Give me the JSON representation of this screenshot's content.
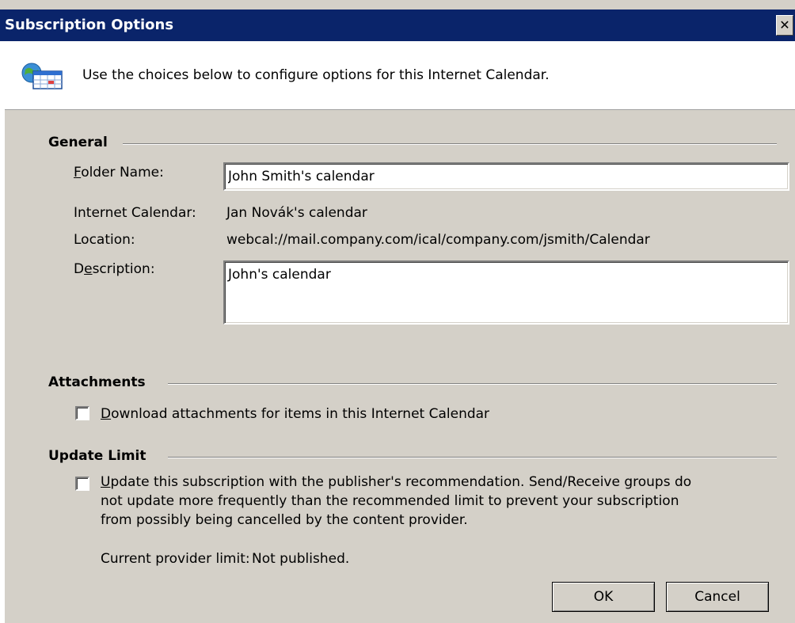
{
  "window": {
    "title": "Subscription Options",
    "close_glyph": "✕"
  },
  "header": {
    "icon": "internet-calendar-icon",
    "text": "Use the choices below to configure options for this Internet Calendar."
  },
  "general": {
    "heading": "General",
    "folder_name": {
      "accel": "F",
      "rest": "older Name:",
      "value": "John Smith's calendar"
    },
    "internet_calendar": {
      "label": "Internet Calendar:",
      "value": "Jan Novák's calendar"
    },
    "location": {
      "label": "Location:",
      "value": "webcal://mail.company.com/ical/company.com/jsmith/Calendar"
    },
    "description": {
      "pre": "D",
      "accel": "e",
      "rest": "scription:",
      "value": "John's calendar"
    }
  },
  "attachments": {
    "heading": "Attachments",
    "checkbox": {
      "checked": false,
      "accel": "D",
      "rest": "ownload attachments for items in this Internet Calendar"
    }
  },
  "update_limit": {
    "heading": "Update Limit",
    "checkbox": {
      "checked": false,
      "accel": "U",
      "line1_rest": "pdate this subscription with the publisher's recommendation. Send/Receive groups do",
      "line2": "not update more frequently than the recommended limit to prevent your subscription",
      "line3": "from possibly being cancelled by the content provider."
    },
    "provider_limit_label": "Current provider limit:",
    "provider_limit_value": "Not published."
  },
  "buttons": {
    "ok": "OK",
    "cancel": "Cancel"
  }
}
